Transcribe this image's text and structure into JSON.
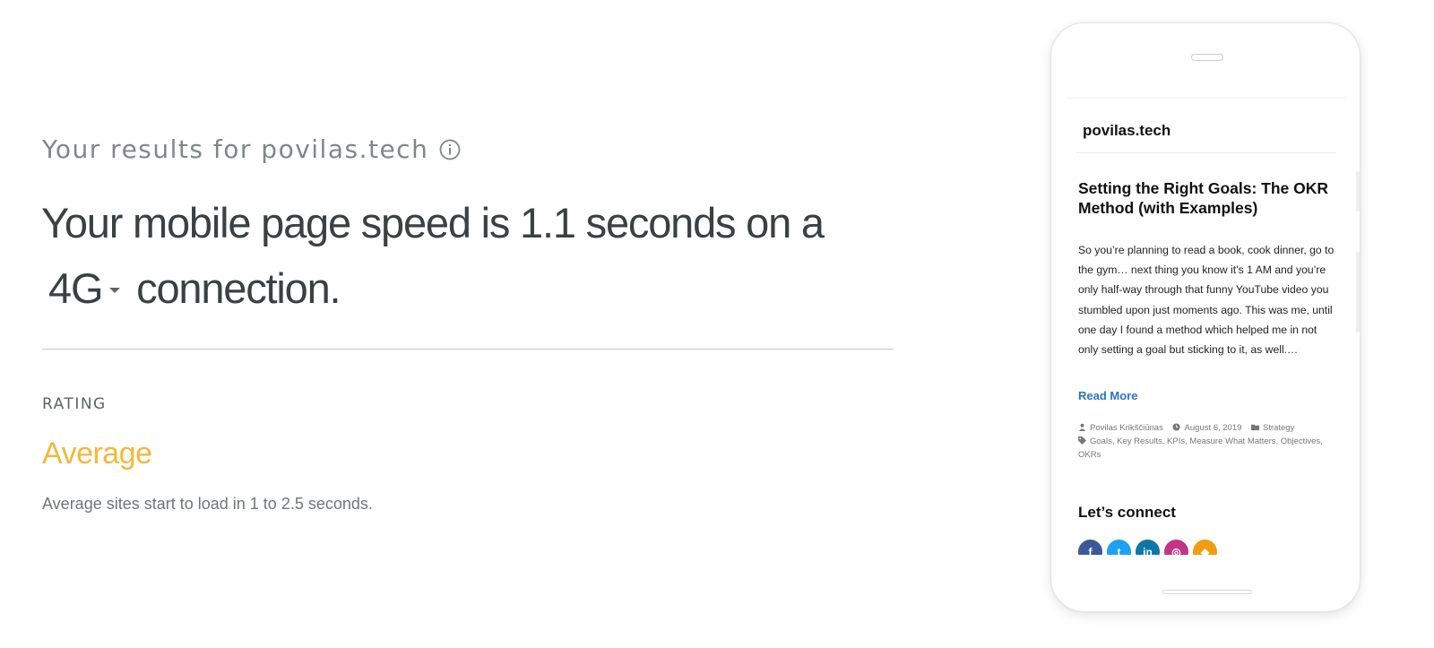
{
  "results": {
    "prefix": "Your results for",
    "domain": "povilas.tech",
    "info_icon": "info-icon"
  },
  "headline": {
    "part1": "Your mobile page speed is 1.1 seconds on a",
    "network": "4G",
    "part2": "connection."
  },
  "rating": {
    "label": "RATING",
    "value": "Average",
    "description": "Average sites start to load in 1 to 2.5 seconds.",
    "color": "#f2b93b"
  },
  "phone_preview": {
    "site_name": "povilas.tech",
    "post_title": "Setting the Right Goals: The OKR Method (with Examples)",
    "excerpt": "So you’re planning to read a book, cook dinner, go to the gym… next thing you know it’s 1 AM and you’re only half-way through that funny YouTube video you stumbled upon just moments ago. This was me, until one day I found a method which helped me in not only setting a goal but sticking to it, as well.…",
    "read_more": "Read More",
    "author": "Povilas Krikščiūnas",
    "date": "August 6, 2019",
    "category": "Strategy",
    "tags": "Goals, Key Results, KPIs, Measure What Matters, Objectives, OKRs",
    "connect_heading": "Let’s connect",
    "socials": [
      {
        "name": "facebook-icon",
        "glyph": "f",
        "color": "#3b5998"
      },
      {
        "name": "twitter-icon",
        "glyph": "t",
        "color": "#1da1f2"
      },
      {
        "name": "linkedin-icon",
        "glyph": "in",
        "color": "#0e76a8"
      },
      {
        "name": "instagram-icon",
        "glyph": "◎",
        "color": "#c13584"
      },
      {
        "name": "rss-icon",
        "glyph": "◆",
        "color": "#f39c12"
      }
    ]
  }
}
